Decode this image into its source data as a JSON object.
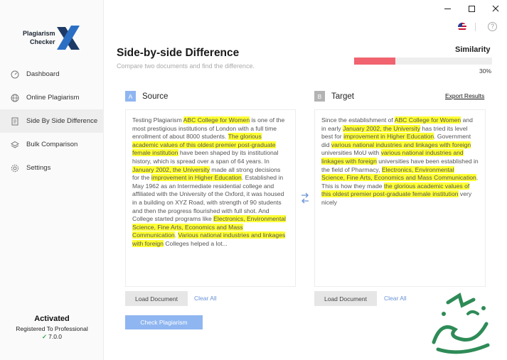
{
  "app": {
    "logo_line1": "Plagiarism",
    "logo_line2": "Checker",
    "logo_mark": "X"
  },
  "window_controls": [
    "minimize",
    "maximize",
    "close"
  ],
  "sidebar": {
    "items": [
      {
        "label": "Dashboard",
        "icon": "gauge-icon"
      },
      {
        "label": "Online Plagiarism",
        "icon": "globe-icon"
      },
      {
        "label": "Side By Side Difference",
        "icon": "document-icon",
        "active": true
      },
      {
        "label": "Bulk Comparison",
        "icon": "layers-icon"
      },
      {
        "label": "Settings",
        "icon": "gear-icon"
      }
    ],
    "activated": {
      "title": "Activated",
      "registered": "Registered To Professional",
      "version": "7.0.0"
    }
  },
  "header": {
    "title": "Side-by-side Difference",
    "subtitle": "Compare two documents and find the difference.",
    "help": "?"
  },
  "similarity": {
    "label": "Similarity",
    "value_text": "30%",
    "value": 0.3,
    "color": "#f0636f"
  },
  "source": {
    "badge": "A",
    "title": "Source",
    "load_label": "Load Document",
    "clear_label": "Clear All",
    "segments": [
      {
        "t": "Testing Plagiarism ",
        "h": false
      },
      {
        "t": "ABC College for Women",
        "h": true
      },
      {
        "t": " is one of the most prestigious institutions of London with a full time enrollment of about 8000 students. ",
        "h": false
      },
      {
        "t": "The glorious academic values of this oldest premier post-graduate female institution",
        "h": true
      },
      {
        "t": " have been shaped by its institutional history, which is spread over a span of 64 years. In ",
        "h": false
      },
      {
        "t": "January 2002, the University",
        "h": true
      },
      {
        "t": " made all strong decisions for the ",
        "h": false
      },
      {
        "t": "improvement in Higher Education",
        "h": true
      },
      {
        "t": ". Established in May 1962 as an Intermediate residential college and affiliated with the University of the Oxford, it was housed in a building on XYZ Road, with strength of 90 students and then the progress flourished with full shot. And College started programs like ",
        "h": false
      },
      {
        "t": "Electronics, Environmental Science, Fine Arts, Economics and Mass Communication",
        "h": true
      },
      {
        "t": ". ",
        "h": false
      },
      {
        "t": "Various national industries and linkages with foreign",
        "h": true
      },
      {
        "t": " Colleges helped a lot...",
        "h": false
      }
    ]
  },
  "target": {
    "badge": "B",
    "title": "Target",
    "export_label": "Export Results",
    "load_label": "Load Document",
    "clear_label": "Clear All",
    "segments": [
      {
        "t": "Since the establishment of ",
        "h": false
      },
      {
        "t": "ABC College for Women",
        "h": true
      },
      {
        "t": " and in early ",
        "h": false
      },
      {
        "t": "January 2002, the University",
        "h": true
      },
      {
        "t": " has tried its level best for ",
        "h": false
      },
      {
        "t": "improvement in Higher Education",
        "h": true
      },
      {
        "t": ". Government did ",
        "h": false
      },
      {
        "t": "various national industries and linkages with foreign",
        "h": true
      },
      {
        "t": " universities MoU with ",
        "h": false
      },
      {
        "t": "various national industries and linkages with foreign",
        "h": true
      },
      {
        "t": " universities have been established in the field of Pharmacy, ",
        "h": false
      },
      {
        "t": "Electronics, Environmental Science, Fine Arts, Economics and Mass Communication",
        "h": true
      },
      {
        "t": ". This is how they made ",
        "h": false
      },
      {
        "t": "the glorious academic values of this oldest premier post-graduate female institution",
        "h": true
      },
      {
        "t": " very nicely",
        "h": false
      }
    ]
  },
  "actions": {
    "check_label": "Check Plagiarism"
  },
  "colors": {
    "accent": "#8fb6f1",
    "highlight": "#ffff33",
    "link": "#6b93d6"
  }
}
